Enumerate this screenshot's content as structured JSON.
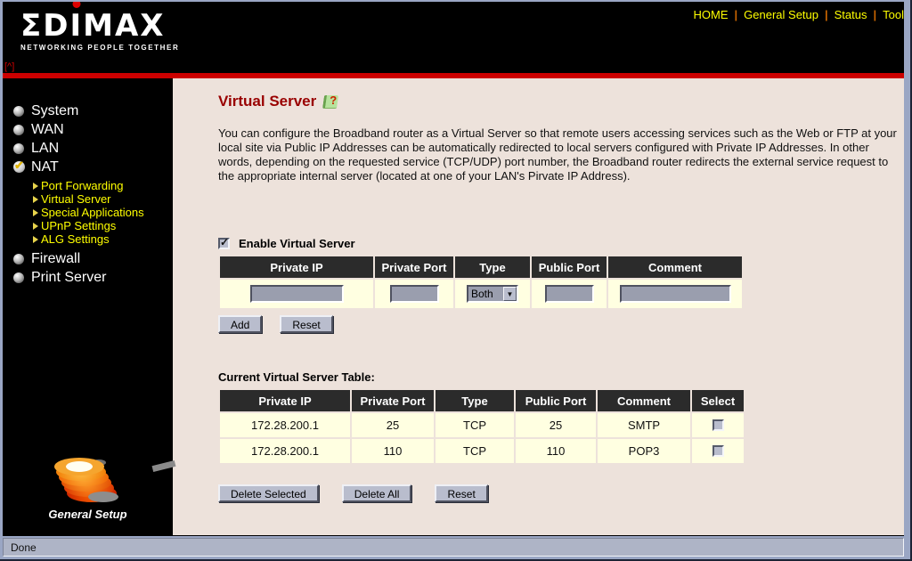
{
  "brand": {
    "logo_text_prefix": "ΣD",
    "logo_text_i": "I",
    "logo_text_suffix": "MAX",
    "tagline": "NETWORKING PEOPLE TOGETHER",
    "broken_marker": "[^]"
  },
  "topnav": {
    "separator": "|",
    "items": [
      {
        "label": "HOME"
      },
      {
        "label": "General Setup"
      },
      {
        "label": "Status"
      },
      {
        "label": "Tool"
      }
    ]
  },
  "sidebar": {
    "items": [
      {
        "label": "System"
      },
      {
        "label": "WAN"
      },
      {
        "label": "LAN"
      },
      {
        "label": "NAT"
      },
      {
        "label": "Firewall"
      },
      {
        "label": "Print Server"
      }
    ],
    "nat_subitems": [
      {
        "label": "Port Forwarding"
      },
      {
        "label": "Virtual Server"
      },
      {
        "label": "Special Applications"
      },
      {
        "label": "UPnP Settings"
      },
      {
        "label": "ALG Settings"
      }
    ],
    "footer_logo_label": "General Setup"
  },
  "main": {
    "title": "Virtual Server",
    "description": "You can configure the Broadband router as a Virtual Server so that remote users accessing services such as the Web or FTP at your local site via Public IP Addresses can be automatically redirected to local servers configured with Private IP Addresses. In other words, depending on the requested service (TCP/UDP) port number, the Broadband router redirects the external service request to the appropriate internal server (located at one of your LAN's Pirvate IP Address).",
    "enable_label": "Enable Virtual Server",
    "enable_checked": true,
    "form_table": {
      "headers": [
        "Private IP",
        "Private Port",
        "Type",
        "Public Port",
        "Comment"
      ],
      "type_selected": "Both",
      "inputs": {
        "private_ip": "",
        "private_port": "",
        "public_port": "",
        "comment": ""
      }
    },
    "form_buttons": {
      "add": "Add",
      "reset": "Reset"
    },
    "current_table": {
      "label": "Current Virtual Server Table:",
      "headers": [
        "Private IP",
        "Private Port",
        "Type",
        "Public Port",
        "Comment",
        "Select"
      ],
      "rows": [
        {
          "private_ip": "172.28.200.1",
          "private_port": "25",
          "type": "TCP",
          "public_port": "25",
          "comment": "SMTP"
        },
        {
          "private_ip": "172.28.200.1",
          "private_port": "110",
          "type": "TCP",
          "public_port": "110",
          "comment": "POP3"
        }
      ]
    },
    "table_buttons": {
      "delete_selected": "Delete Selected",
      "delete_all": "Delete All",
      "reset": "Reset"
    }
  },
  "statusbar": {
    "text": "Done"
  },
  "colors": {
    "red_bar": "#cc0000",
    "title": "#990000",
    "nav_link": "#ffff00",
    "nav_separator": "#cc6600",
    "main_bg": "#ede2db",
    "row_bg": "#ffffe1",
    "table_header_bg": "#2b2b2b",
    "frame": "#9aa6c4"
  }
}
